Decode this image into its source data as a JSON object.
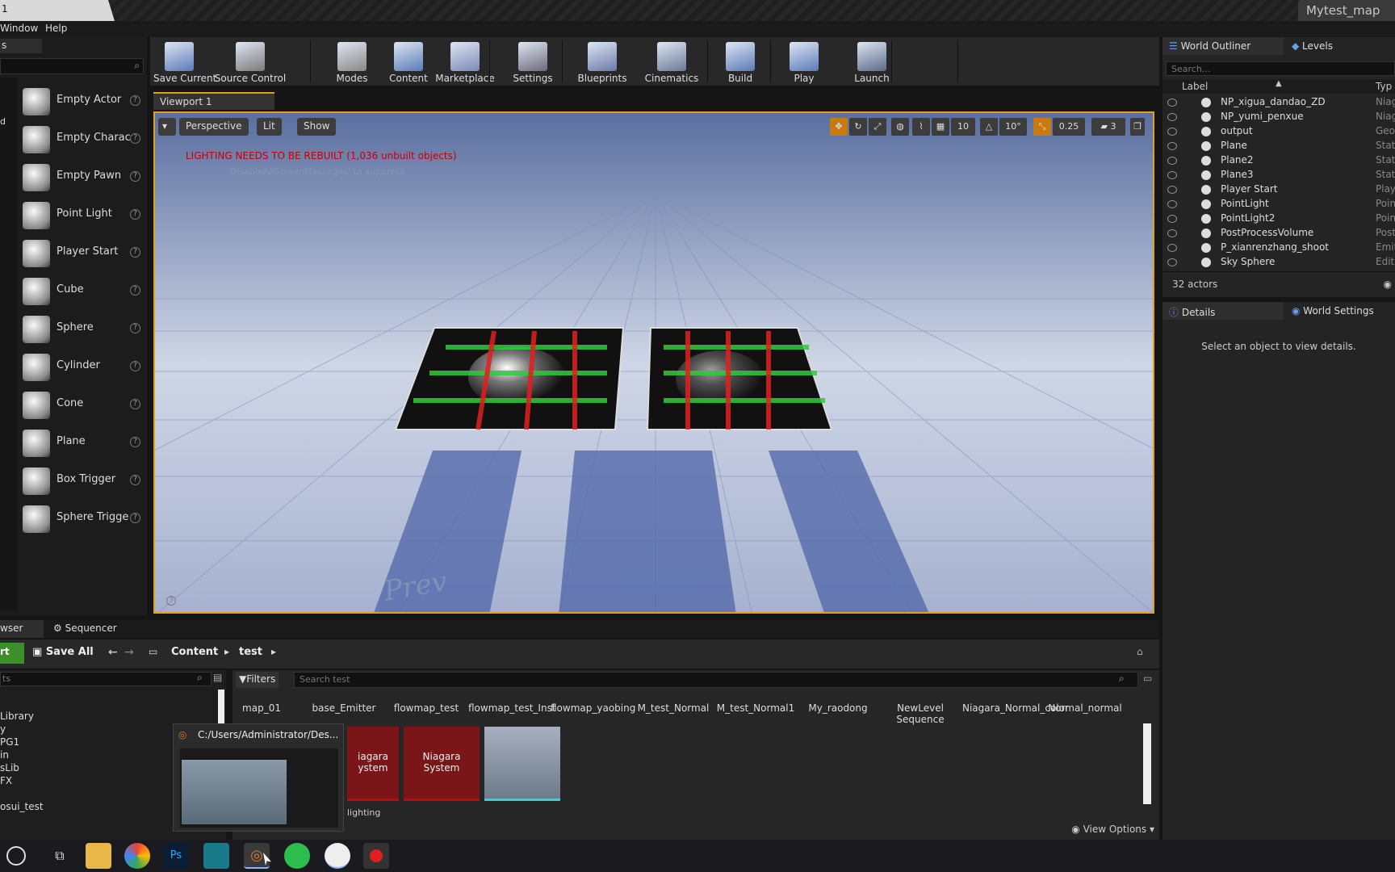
{
  "window": {
    "title_tab": "1",
    "map_tab": "Mytest_map"
  },
  "menu": {
    "window": "Window",
    "help": "Help"
  },
  "place_panel": {
    "tab": "s",
    "items": [
      {
        "label": "Empty Actor",
        "icon": "sphere-icon"
      },
      {
        "label": "Empty Charac",
        "icon": "character-icon"
      },
      {
        "label": "Empty Pawn",
        "icon": "pawn-icon"
      },
      {
        "label": "Point Light",
        "icon": "light-bulb-icon"
      },
      {
        "label": "Player Start",
        "icon": "player-start-icon"
      },
      {
        "label": "Cube",
        "icon": "cube-icon"
      },
      {
        "label": "Sphere",
        "icon": "sphere-icon"
      },
      {
        "label": "Cylinder",
        "icon": "cylinder-icon"
      },
      {
        "label": "Cone",
        "icon": "cone-icon"
      },
      {
        "label": "Plane",
        "icon": "plane-icon"
      },
      {
        "label": "Box Trigger",
        "icon": "box-trigger-icon"
      },
      {
        "label": "Sphere Trigge",
        "icon": "sphere-trigger-icon"
      }
    ]
  },
  "toolbar": {
    "buttons": [
      {
        "label": "Save Current",
        "icon": "save-icon"
      },
      {
        "label": "Source Control",
        "icon": "source-control-icon"
      },
      {
        "label": "Modes",
        "icon": "modes-icon"
      },
      {
        "label": "Content",
        "icon": "content-icon"
      },
      {
        "label": "Marketplace",
        "icon": "marketplace-icon"
      },
      {
        "label": "Settings",
        "icon": "settings-icon"
      },
      {
        "label": "Blueprints",
        "icon": "blueprints-icon"
      },
      {
        "label": "Cinematics",
        "icon": "cinematics-icon"
      },
      {
        "label": "Build",
        "icon": "build-icon"
      },
      {
        "label": "Play",
        "icon": "play-icon"
      },
      {
        "label": "Launch",
        "icon": "launch-icon"
      }
    ]
  },
  "viewport": {
    "tab": "Viewport 1",
    "perspective": "Perspective",
    "lit": "Lit",
    "show": "Show",
    "grid_snap": "10",
    "rotation_snap": "10°",
    "scale_snap": "0.25",
    "camera_speed": "3",
    "warning": "LIGHTING NEEDS TO BE REBUILT (1,036 unbuilt objects)",
    "suppress_hint": "'DisableAllScreenMessages' to suppress",
    "watermark": "Prev"
  },
  "outliner": {
    "tab": "World Outliner",
    "levels_tab": "Levels",
    "search_placeholder": "Search...",
    "col_label": "Label",
    "col_type": "Typ",
    "rows": [
      {
        "name": "NP_xigua_dandao_ZD",
        "type": "Niag"
      },
      {
        "name": "NP_yumi_penxue",
        "type": "Niag"
      },
      {
        "name": "output",
        "type": "Geor"
      },
      {
        "name": "Plane",
        "type": "Stati"
      },
      {
        "name": "Plane2",
        "type": "Stati"
      },
      {
        "name": "Plane3",
        "type": "Stati"
      },
      {
        "name": "Player Start",
        "type": "Play"
      },
      {
        "name": "PointLight",
        "type": "Poin"
      },
      {
        "name": "PointLight2",
        "type": "Poin"
      },
      {
        "name": "PostProcessVolume",
        "type": "Post"
      },
      {
        "name": "P_xianrenzhang_shoot",
        "type": "Emit"
      },
      {
        "name": "Sky Sphere",
        "type": "Edit"
      }
    ],
    "count": "32 actors"
  },
  "details": {
    "tab": "Details",
    "world_settings_tab": "World Settings",
    "empty_message": "Select an object to view details."
  },
  "content_browser": {
    "tab": "wser",
    "sequencer_tab": "Sequencer",
    "import_label": "rt",
    "save_all": "Save All",
    "path": [
      "Content",
      "test"
    ],
    "filters": "Filters",
    "search_placeholder": "Search test",
    "left_search_placeholder": "ts",
    "folders": [
      "Library",
      "y",
      "PG1",
      "in",
      "sLib",
      "FX",
      "",
      "osui_test"
    ],
    "assets": [
      {
        "name": "map_01"
      },
      {
        "name": "base_Emitter"
      },
      {
        "name": "flowmap_test"
      },
      {
        "name": "flowmap_test_Inst"
      },
      {
        "name": "flowmap_yaobing"
      },
      {
        "name": "M_test_Normal"
      },
      {
        "name": "M_test_Normal1"
      },
      {
        "name": "My_raodong"
      },
      {
        "name": "NewLevel Sequence"
      },
      {
        "name": "Niagara_Normal_color"
      },
      {
        "name": "Normal_normal"
      }
    ],
    "thumb_labels": [
      "iagara\nystem",
      "Niagara\nSystem"
    ],
    "lighting_label": "lighting",
    "view_options": "View Options"
  },
  "taskbar_preview": {
    "title": "C:/Users/Administrator/Des..."
  },
  "colors": {
    "accent": "#e0a020",
    "warning": "#c40000",
    "niagara": "#7a1518"
  }
}
